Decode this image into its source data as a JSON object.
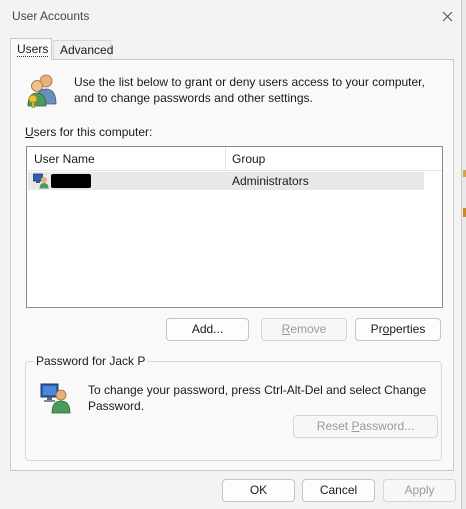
{
  "window": {
    "title": "User Accounts"
  },
  "tabs": [
    {
      "label": "Users",
      "active": true
    },
    {
      "label": "Advanced",
      "active": false
    }
  ],
  "intro": {
    "line1": "Use the list below to grant or deny users access to your computer,",
    "line2": "and to change passwords and other settings."
  },
  "users_section": {
    "label_first": "U",
    "label_rest": "sers for this computer:",
    "columns": [
      "User Name",
      "Group"
    ],
    "rows": [
      {
        "user_name": "",
        "group": "Administrators",
        "selected": true
      }
    ]
  },
  "user_buttons": {
    "add_first": "Add...",
    "remove_first": "R",
    "remove_rest": "emove",
    "properties_a": "Pr",
    "properties_u": "o",
    "properties_b": "perties"
  },
  "password": {
    "group_title": "Password for Jack P",
    "line1": "To change your password, press Ctrl-Alt-Del and select Change",
    "line2": "Password.",
    "reset_a": "Reset ",
    "reset_u": "P",
    "reset_b": "assword..."
  },
  "footer": {
    "ok": "OK",
    "cancel": "Cancel",
    "apply": "Apply"
  },
  "icons": {
    "close": "close-icon",
    "users": "users-key-icon",
    "user_row": "user-computer-icon",
    "password": "user-computer-icon"
  },
  "colors": {
    "accent": "#0067c0",
    "disabled_text": "#9a9a9a",
    "selected_row": "#e8e8e8"
  }
}
